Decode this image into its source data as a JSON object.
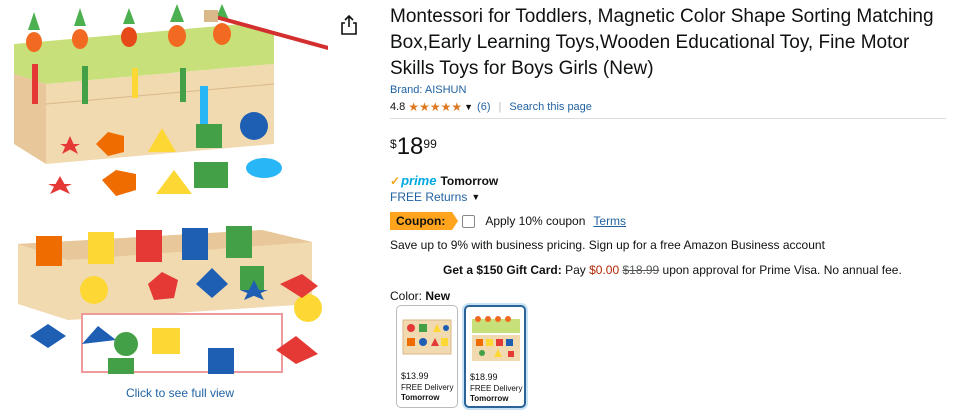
{
  "product": {
    "title": "Montessori for Toddlers, Magnetic Color Shape Sorting Matching Box,Early Learning Toys,Wooden Educational Toy, Fine Motor Skills Toys for Boys Girls (New)",
    "brand_text": "Brand: AISHUN",
    "rating_value": "4.8",
    "rating_stars": 4.8,
    "rating_count": "(6)",
    "search_page": "Search this page",
    "click_full_view": "Click to see full view"
  },
  "price": {
    "symbol": "$",
    "whole": "18",
    "fraction": "99"
  },
  "delivery": {
    "prime_check": "✓",
    "prime_label": "prime",
    "day": "Tomorrow",
    "free_returns": "FREE Returns"
  },
  "coupon": {
    "badge": "Coupon:",
    "apply_text": "Apply 10% coupon",
    "terms": "Terms"
  },
  "business_text": "Save up to 9% with business pricing. Sign up for a free Amazon Business account",
  "gift_card": {
    "bold": "Get a $150 Gift Card:",
    "pay": "Pay",
    "price": "$0.00",
    "strike": "$18.99",
    "rest": "upon approval for Prime Visa. No annual fee."
  },
  "color": {
    "label": "Color:",
    "value": "New",
    "options": [
      {
        "price": "$13.99",
        "delivery": "FREE Delivery",
        "day": "Tomorrow"
      },
      {
        "price": "$18.99",
        "delivery": "FREE Delivery",
        "day": "Tomorrow"
      }
    ]
  },
  "colors": {
    "link": "#2162a1",
    "star": "#de7921",
    "coupon": "#ffa41c",
    "prime": "#00a8e1",
    "deal_price": "#b12704"
  },
  "icons": [
    "share-icon",
    "star-icon",
    "chevron-down-icon",
    "prime-check-icon"
  ]
}
